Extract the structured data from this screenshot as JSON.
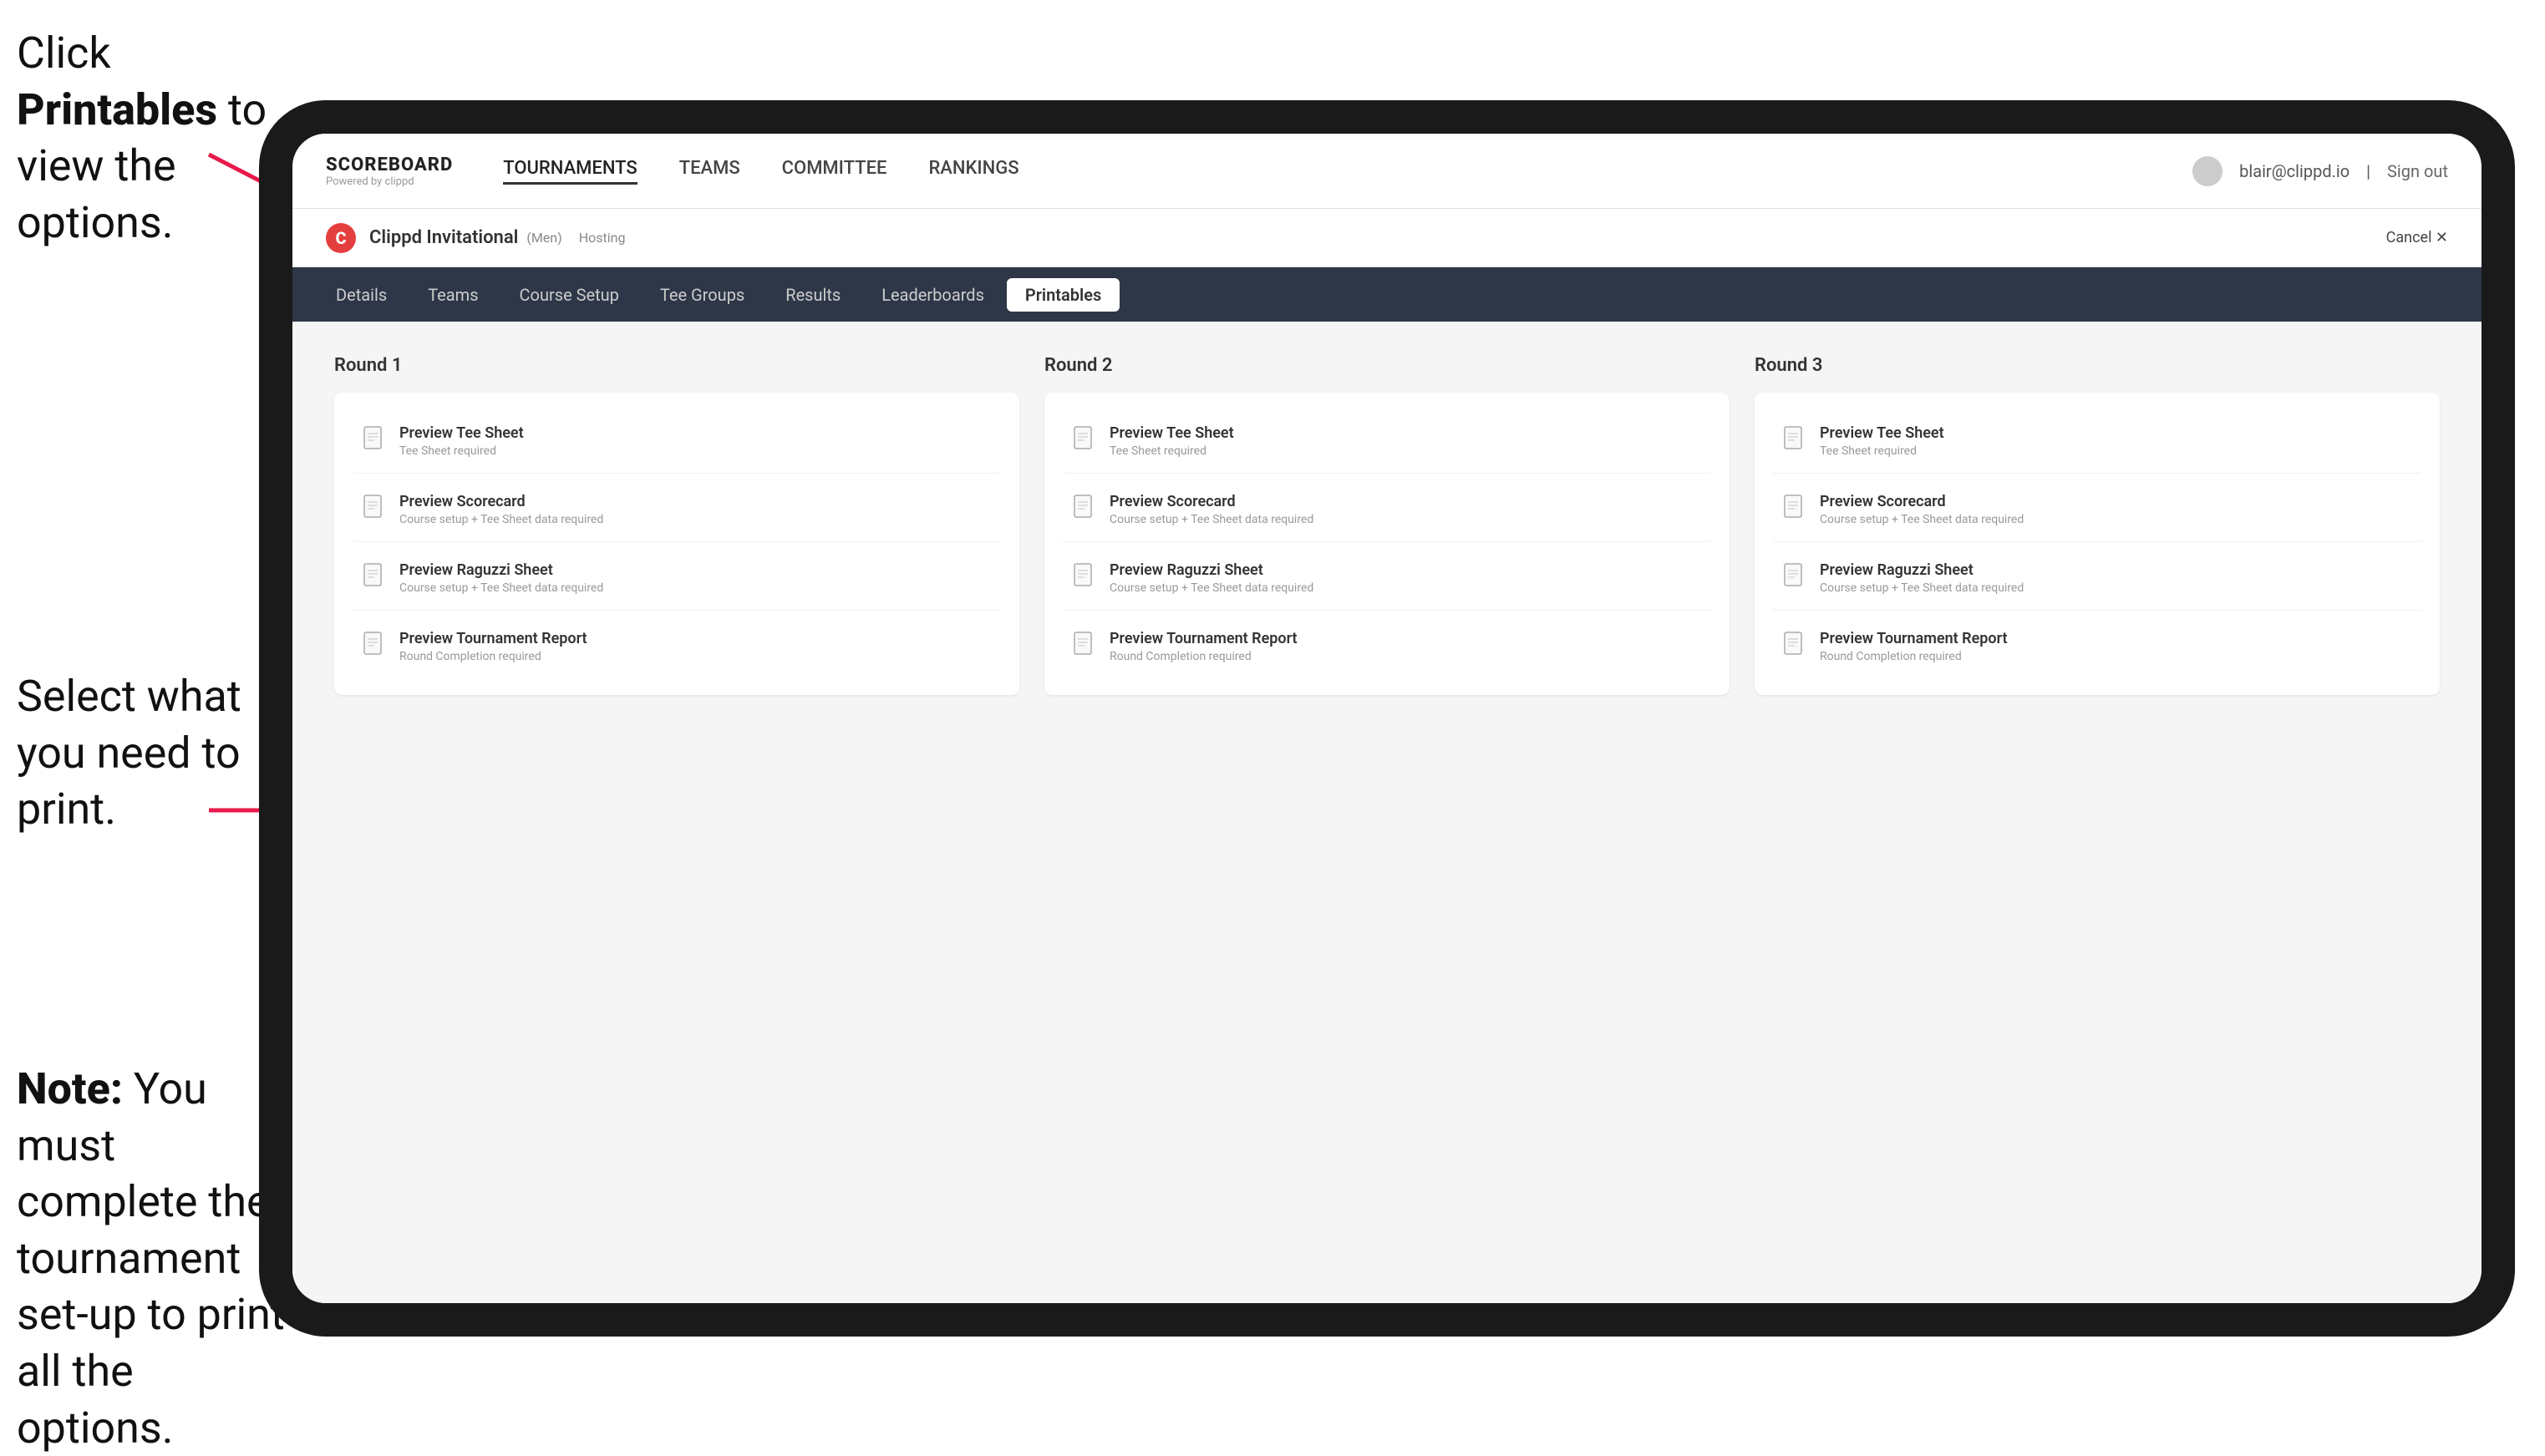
{
  "instructions": {
    "top": {
      "line1": "Click ",
      "bold": "Printables",
      "line2": " to view the options."
    },
    "mid": {
      "text": "Select what you need to print."
    },
    "bottom": {
      "bold": "Note:",
      "text": " You must complete the tournament set-up to print all the options."
    }
  },
  "nav": {
    "logo_title": "SCOREBOARD",
    "logo_sub": "Powered by clippd",
    "links": [
      {
        "label": "TOURNAMENTS",
        "active": false
      },
      {
        "label": "TEAMS",
        "active": false
      },
      {
        "label": "COMMITTEE",
        "active": false
      },
      {
        "label": "RANKINGS",
        "active": false
      }
    ],
    "user_email": "blair@clippd.io",
    "sign_out": "Sign out"
  },
  "tournament": {
    "logo_letter": "C",
    "name": "Clippd Invitational",
    "badge": "(Men)",
    "status": "Hosting",
    "cancel_label": "Cancel ✕"
  },
  "sub_tabs": [
    {
      "label": "Details",
      "active": false
    },
    {
      "label": "Teams",
      "active": false
    },
    {
      "label": "Course Setup",
      "active": false
    },
    {
      "label": "Tee Groups",
      "active": false
    },
    {
      "label": "Results",
      "active": false
    },
    {
      "label": "Leaderboards",
      "active": false
    },
    {
      "label": "Printables",
      "active": true
    }
  ],
  "rounds": [
    {
      "title": "Round 1",
      "cards": [
        {
          "title": "Preview Tee Sheet",
          "sub": "Tee Sheet required"
        },
        {
          "title": "Preview Scorecard",
          "sub": "Course setup + Tee Sheet data required"
        },
        {
          "title": "Preview Raguzzi Sheet",
          "sub": "Course setup + Tee Sheet data required"
        },
        {
          "title": "Preview Tournament Report",
          "sub": "Round Completion required"
        }
      ]
    },
    {
      "title": "Round 2",
      "cards": [
        {
          "title": "Preview Tee Sheet",
          "sub": "Tee Sheet required"
        },
        {
          "title": "Preview Scorecard",
          "sub": "Course setup + Tee Sheet data required"
        },
        {
          "title": "Preview Raguzzi Sheet",
          "sub": "Course setup + Tee Sheet data required"
        },
        {
          "title": "Preview Tournament Report",
          "sub": "Round Completion required"
        }
      ]
    },
    {
      "title": "Round 3",
      "cards": [
        {
          "title": "Preview Tee Sheet",
          "sub": "Tee Sheet required"
        },
        {
          "title": "Preview Scorecard",
          "sub": "Course setup + Tee Sheet data required"
        },
        {
          "title": "Preview Raguzzi Sheet",
          "sub": "Course setup + Tee Sheet data required"
        },
        {
          "title": "Preview Tournament Report",
          "sub": "Round Completion required"
        }
      ]
    }
  ]
}
